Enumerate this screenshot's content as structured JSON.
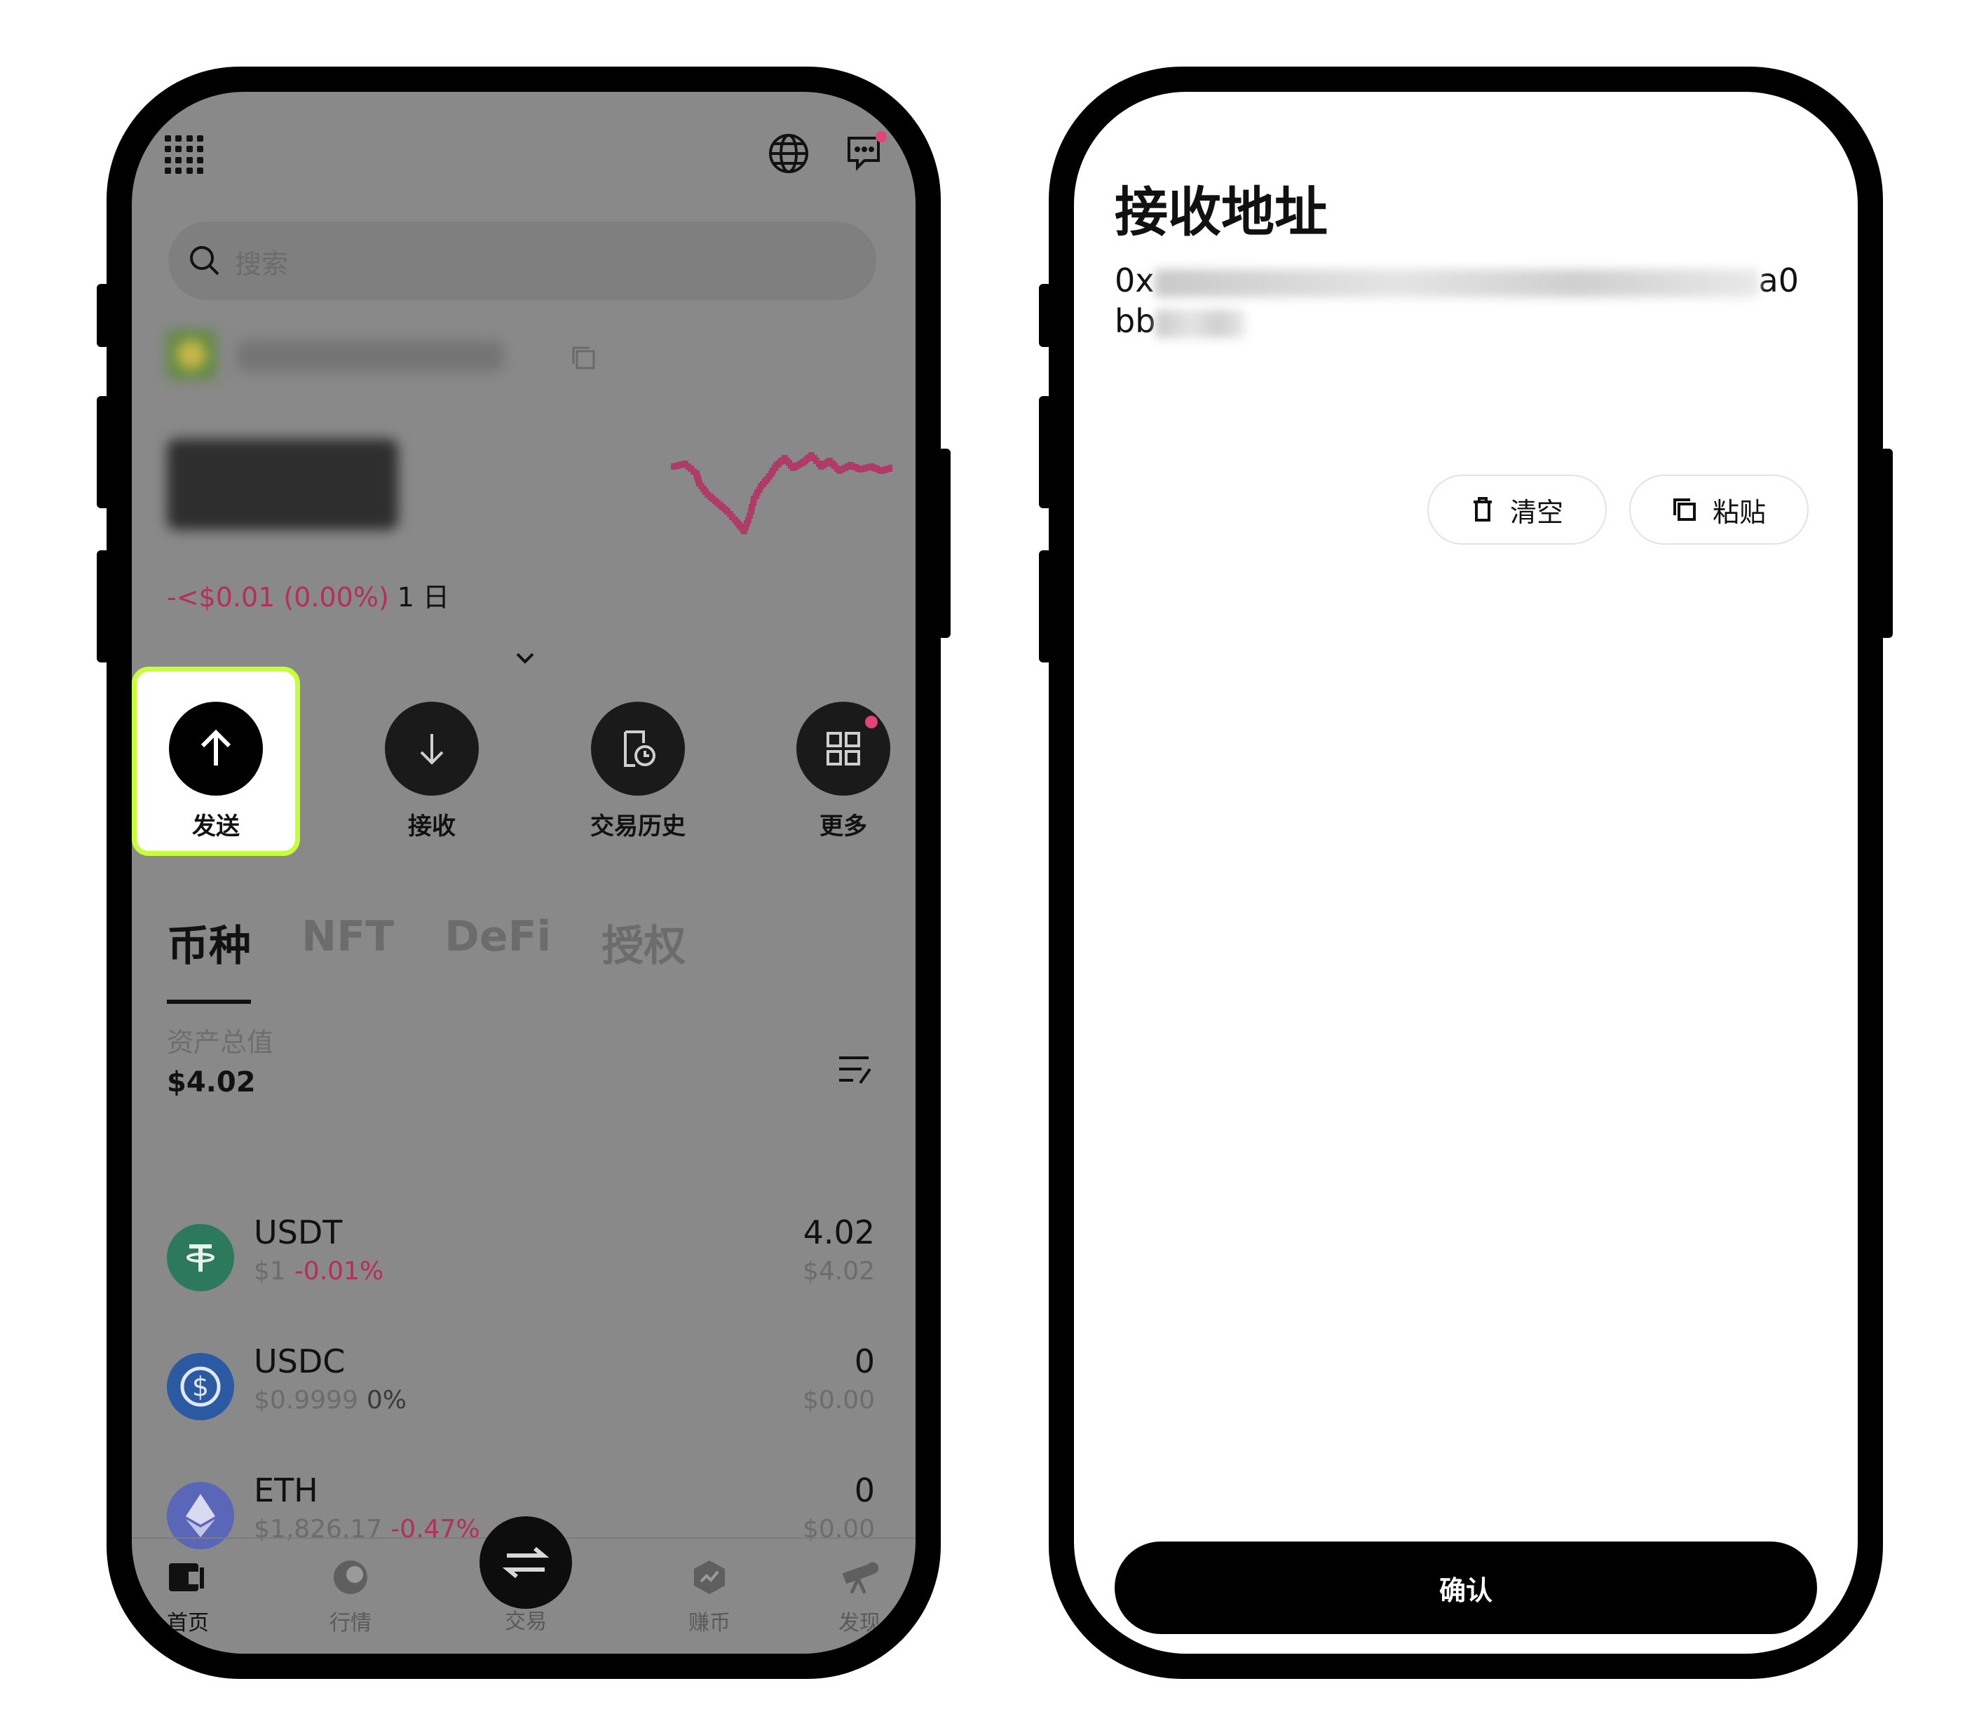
{
  "left_screen": {
    "search": {
      "placeholder": "搜索"
    },
    "wallet": {
      "change": "-<$0.01 (0.00%)",
      "period": "1 日"
    },
    "actions": [
      {
        "label": "发送",
        "icon": "arrow-up-icon",
        "highlighted": true
      },
      {
        "label": "接收",
        "icon": "arrow-down-icon"
      },
      {
        "label": "交易历史",
        "icon": "history-icon"
      },
      {
        "label": "更多",
        "icon": "grid-icon"
      }
    ],
    "tabs": [
      "币种",
      "NFT",
      "DeFi",
      "授权"
    ],
    "active_tab": "币种",
    "total": {
      "label": "资产总值",
      "value": "$4.02"
    },
    "assets": [
      {
        "name": "USDT",
        "price": "$1",
        "change": "-0.01%",
        "amount": "4.02",
        "value": "$4.02",
        "color": "#2c7a5b"
      },
      {
        "name": "USDC",
        "price": "$0.9999",
        "change": "0%",
        "amount": "0",
        "value": "$0.00",
        "color": "#2b5aa3"
      },
      {
        "name": "ETH",
        "price": "$1,826.17",
        "change": "-0.47%",
        "amount": "0",
        "value": "$0.00",
        "color": "#5a66b8"
      }
    ],
    "bottom_nav": [
      "首页",
      "行情",
      "交易",
      "赚币",
      "发现"
    ],
    "highlight_color": "#c6ff3a",
    "negative_color": "#b4305a"
  },
  "right_screen": {
    "title": "接收地址",
    "address_line1_start": "0x",
    "address_line1_end": "a0",
    "address_line2_start": "bb",
    "clear_label": "清空",
    "paste_label": "粘贴",
    "confirm_label": "确认"
  }
}
